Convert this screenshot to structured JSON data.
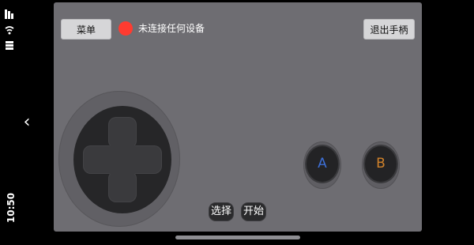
{
  "system": {
    "time": "10:50",
    "icons": [
      "signal-icon",
      "wifi-icon",
      "battery-icon"
    ],
    "back_glyph": "‹"
  },
  "header": {
    "menu_label": "菜单",
    "connection_status": "未连接任何设备",
    "status_color": "#ff3b30",
    "exit_label": "退出手柄"
  },
  "controls": {
    "a_label": "A",
    "b_label": "B",
    "a_color": "#3d6fd6",
    "b_color": "#d0822b",
    "select_label": "选择",
    "start_label": "开始"
  },
  "colors": {
    "panel": "#6e6d72",
    "background": "#000000"
  }
}
